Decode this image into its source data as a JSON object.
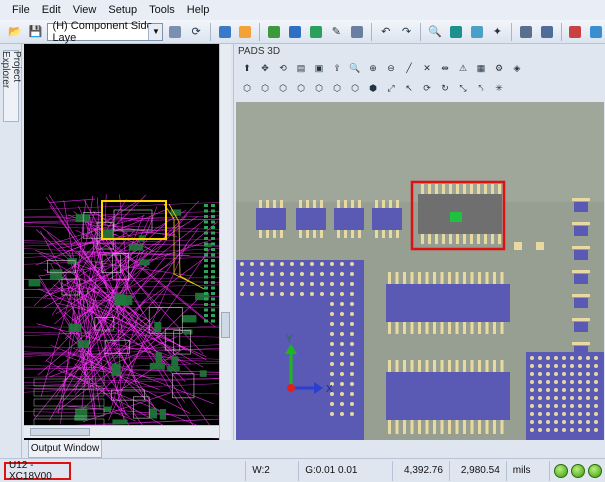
{
  "menu": {
    "items": [
      "File",
      "Edit",
      "View",
      "Setup",
      "Tools",
      "Help"
    ]
  },
  "toolbar": {
    "layer_select": "(H) Component Side Laye"
  },
  "sidebar": {
    "project_explorer_label": "Project Explorer"
  },
  "output": {
    "tab_label": "Output Window"
  },
  "pads3d": {
    "title": "PADS 3D",
    "axes": {
      "y": "Y",
      "x": "X"
    },
    "highlight_color": "#d11"
  },
  "status": {
    "selection": "U12 - XC18V00",
    "w": "W:2",
    "grid": "G:0.01 0.01",
    "x": "4,392.76",
    "y": "2,980.54",
    "units": "mils"
  },
  "colors": {
    "board_bg": "#000000",
    "trace": "#ff33ff",
    "pad_3d": "#5a5ab5",
    "pin_gold": "#e8d9a0",
    "select_box": "#ffd400"
  }
}
